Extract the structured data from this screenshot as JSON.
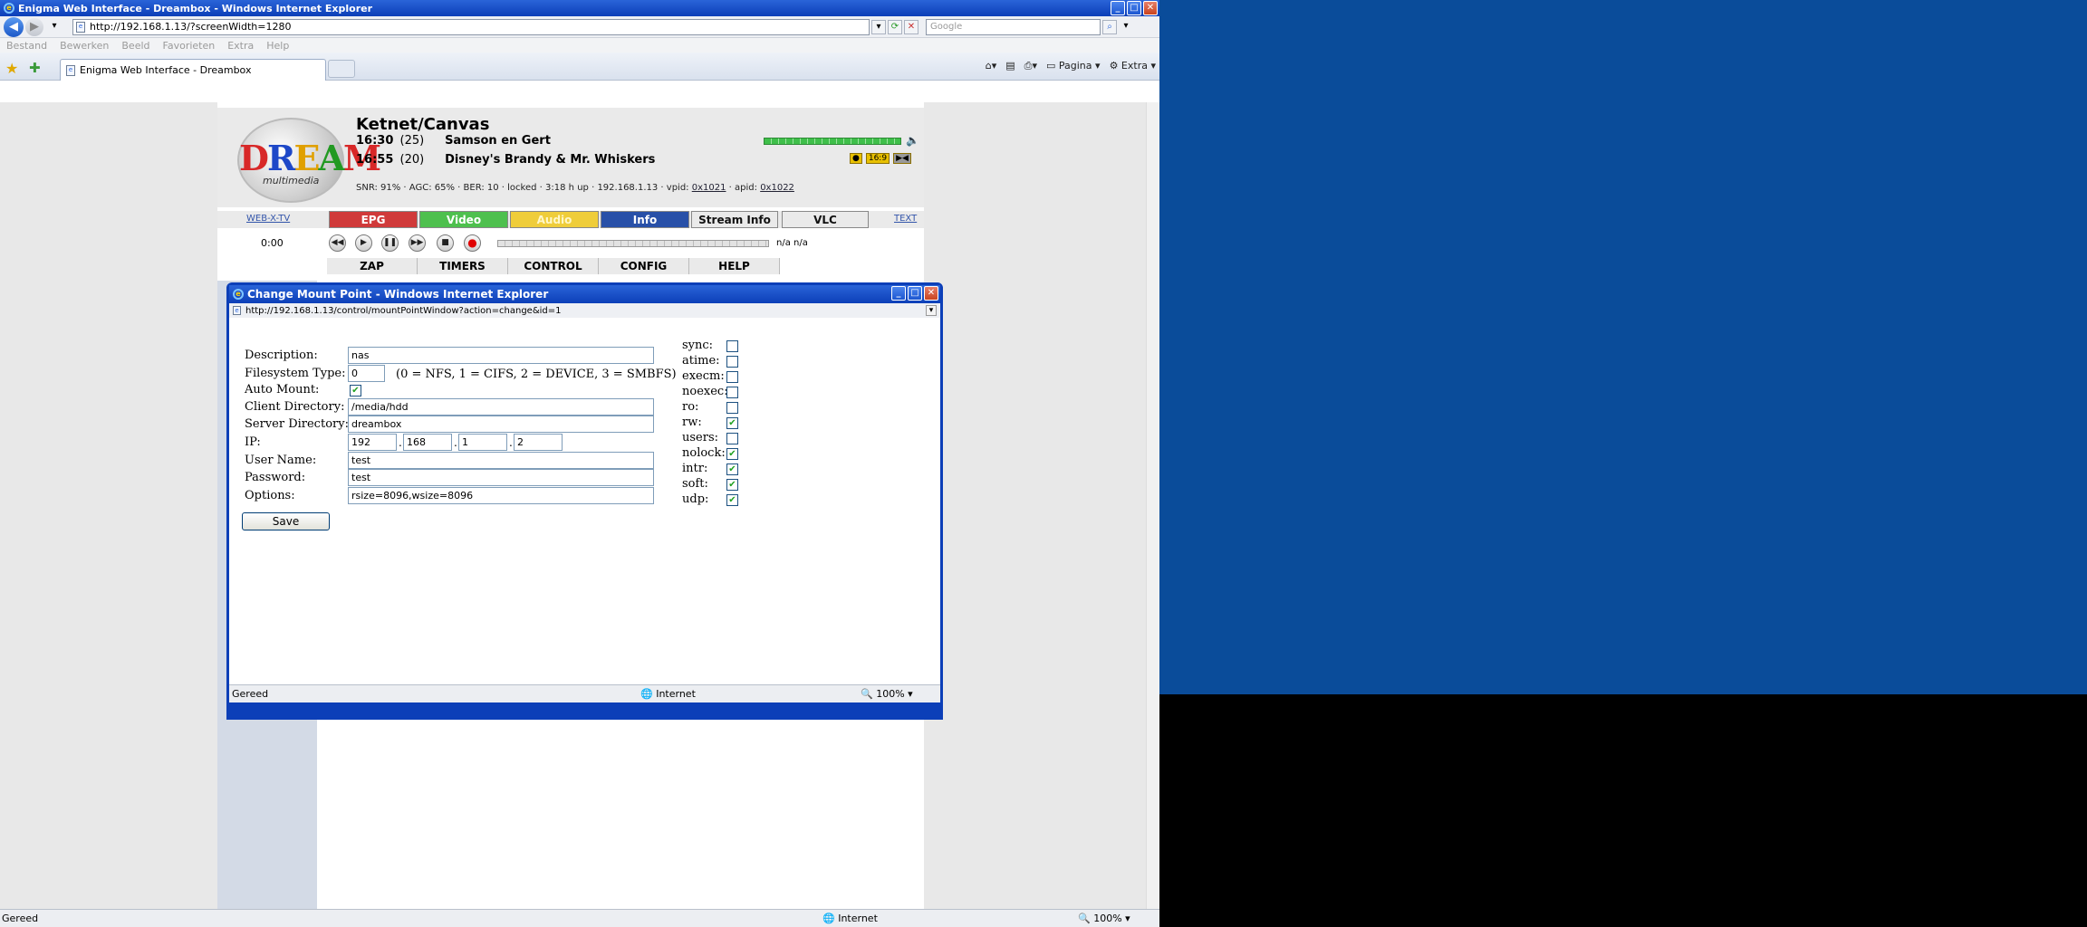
{
  "window": {
    "title": "Enigma Web Interface - Dreambox - Windows Internet Explorer",
    "url": "http://192.168.1.13/?screenWidth=1280",
    "search_placeholder": "Google",
    "menu": [
      "Bestand",
      "Bewerken",
      "Beeld",
      "Favorieten",
      "Extra",
      "Help"
    ],
    "tab_title": "Enigma Web Interface - Dreambox",
    "cmd": {
      "page": "Pagina",
      "extra": "Extra"
    },
    "status": "Gereed",
    "zone": "Internet",
    "zoom": "100%"
  },
  "dreambox": {
    "logo_text": "DREAM",
    "logo_sub": "multimedia",
    "channel": "Ketnet/Canvas",
    "events": [
      {
        "time": "16:30",
        "duration": "(25)",
        "title": "Samson en Gert"
      },
      {
        "time": "16:55",
        "duration": "(20)",
        "title": "Disney's Brandy & Mr. Whiskers"
      }
    ],
    "signal_level": 1.0,
    "status_line": {
      "snr": "SNR: 91%",
      "agc": "AGC: 65%",
      "ber": "BER: 10",
      "lock": "locked",
      "uptime": "3:18 h up",
      "ip": "192.168.1.13",
      "vpid_label": "vpid:",
      "vpid": "0x1021",
      "apid_label": "apid:",
      "apid": "0x1022"
    },
    "nav_links": {
      "webxtv": "WEB-X-TV",
      "text": "TEXT"
    },
    "color_buttons": {
      "epg": "EPG",
      "video": "Video",
      "audio": "Audio",
      "info": "Info",
      "stream": "Stream Info",
      "vlc": "VLC"
    },
    "position": "0:00",
    "position2": "n/a n/a",
    "main_nav": [
      "ZAP",
      "TIMERS",
      "CONTROL",
      "CONFIG",
      "HELP"
    ]
  },
  "popup": {
    "title": "Change Mount Point - Windows Internet Explorer",
    "url": "http://192.168.1.13/control/mountPointWindow?action=change&id=1",
    "labels": {
      "description": "Description:",
      "fstype": "Filesystem Type:",
      "automount": "Auto Mount:",
      "clientdir": "Client Directory:",
      "serverdir": "Server Directory:",
      "ip": "IP:",
      "username": "User Name:",
      "password": "Password:",
      "options": "Options:"
    },
    "values": {
      "description": "nas",
      "fstype": "0",
      "clientdir": "/media/hdd",
      "serverdir": "dreambox",
      "ip": [
        "192",
        "168",
        "1",
        "2"
      ],
      "username": "test",
      "password": "test",
      "options": "rsize=8096,wsize=8096"
    },
    "fstype_hint": "(0 = NFS, 1 = CIFS, 2 = DEVICE, 3 = SMBFS)",
    "flags": [
      {
        "label": "sync:",
        "checked": false
      },
      {
        "label": "atime:",
        "checked": false
      },
      {
        "label": "execm:",
        "checked": false
      },
      {
        "label": "noexec:",
        "checked": false
      },
      {
        "label": "ro:",
        "checked": false
      },
      {
        "label": "rw:",
        "checked": true
      },
      {
        "label": "users:",
        "checked": false
      },
      {
        "label": "nolock:",
        "checked": true
      },
      {
        "label": "intr:",
        "checked": true
      },
      {
        "label": "soft:",
        "checked": true
      },
      {
        "label": "udp:",
        "checked": true
      }
    ],
    "save_label": "Save",
    "status": "Gereed",
    "zone": "Internet",
    "zoom": "100%"
  }
}
